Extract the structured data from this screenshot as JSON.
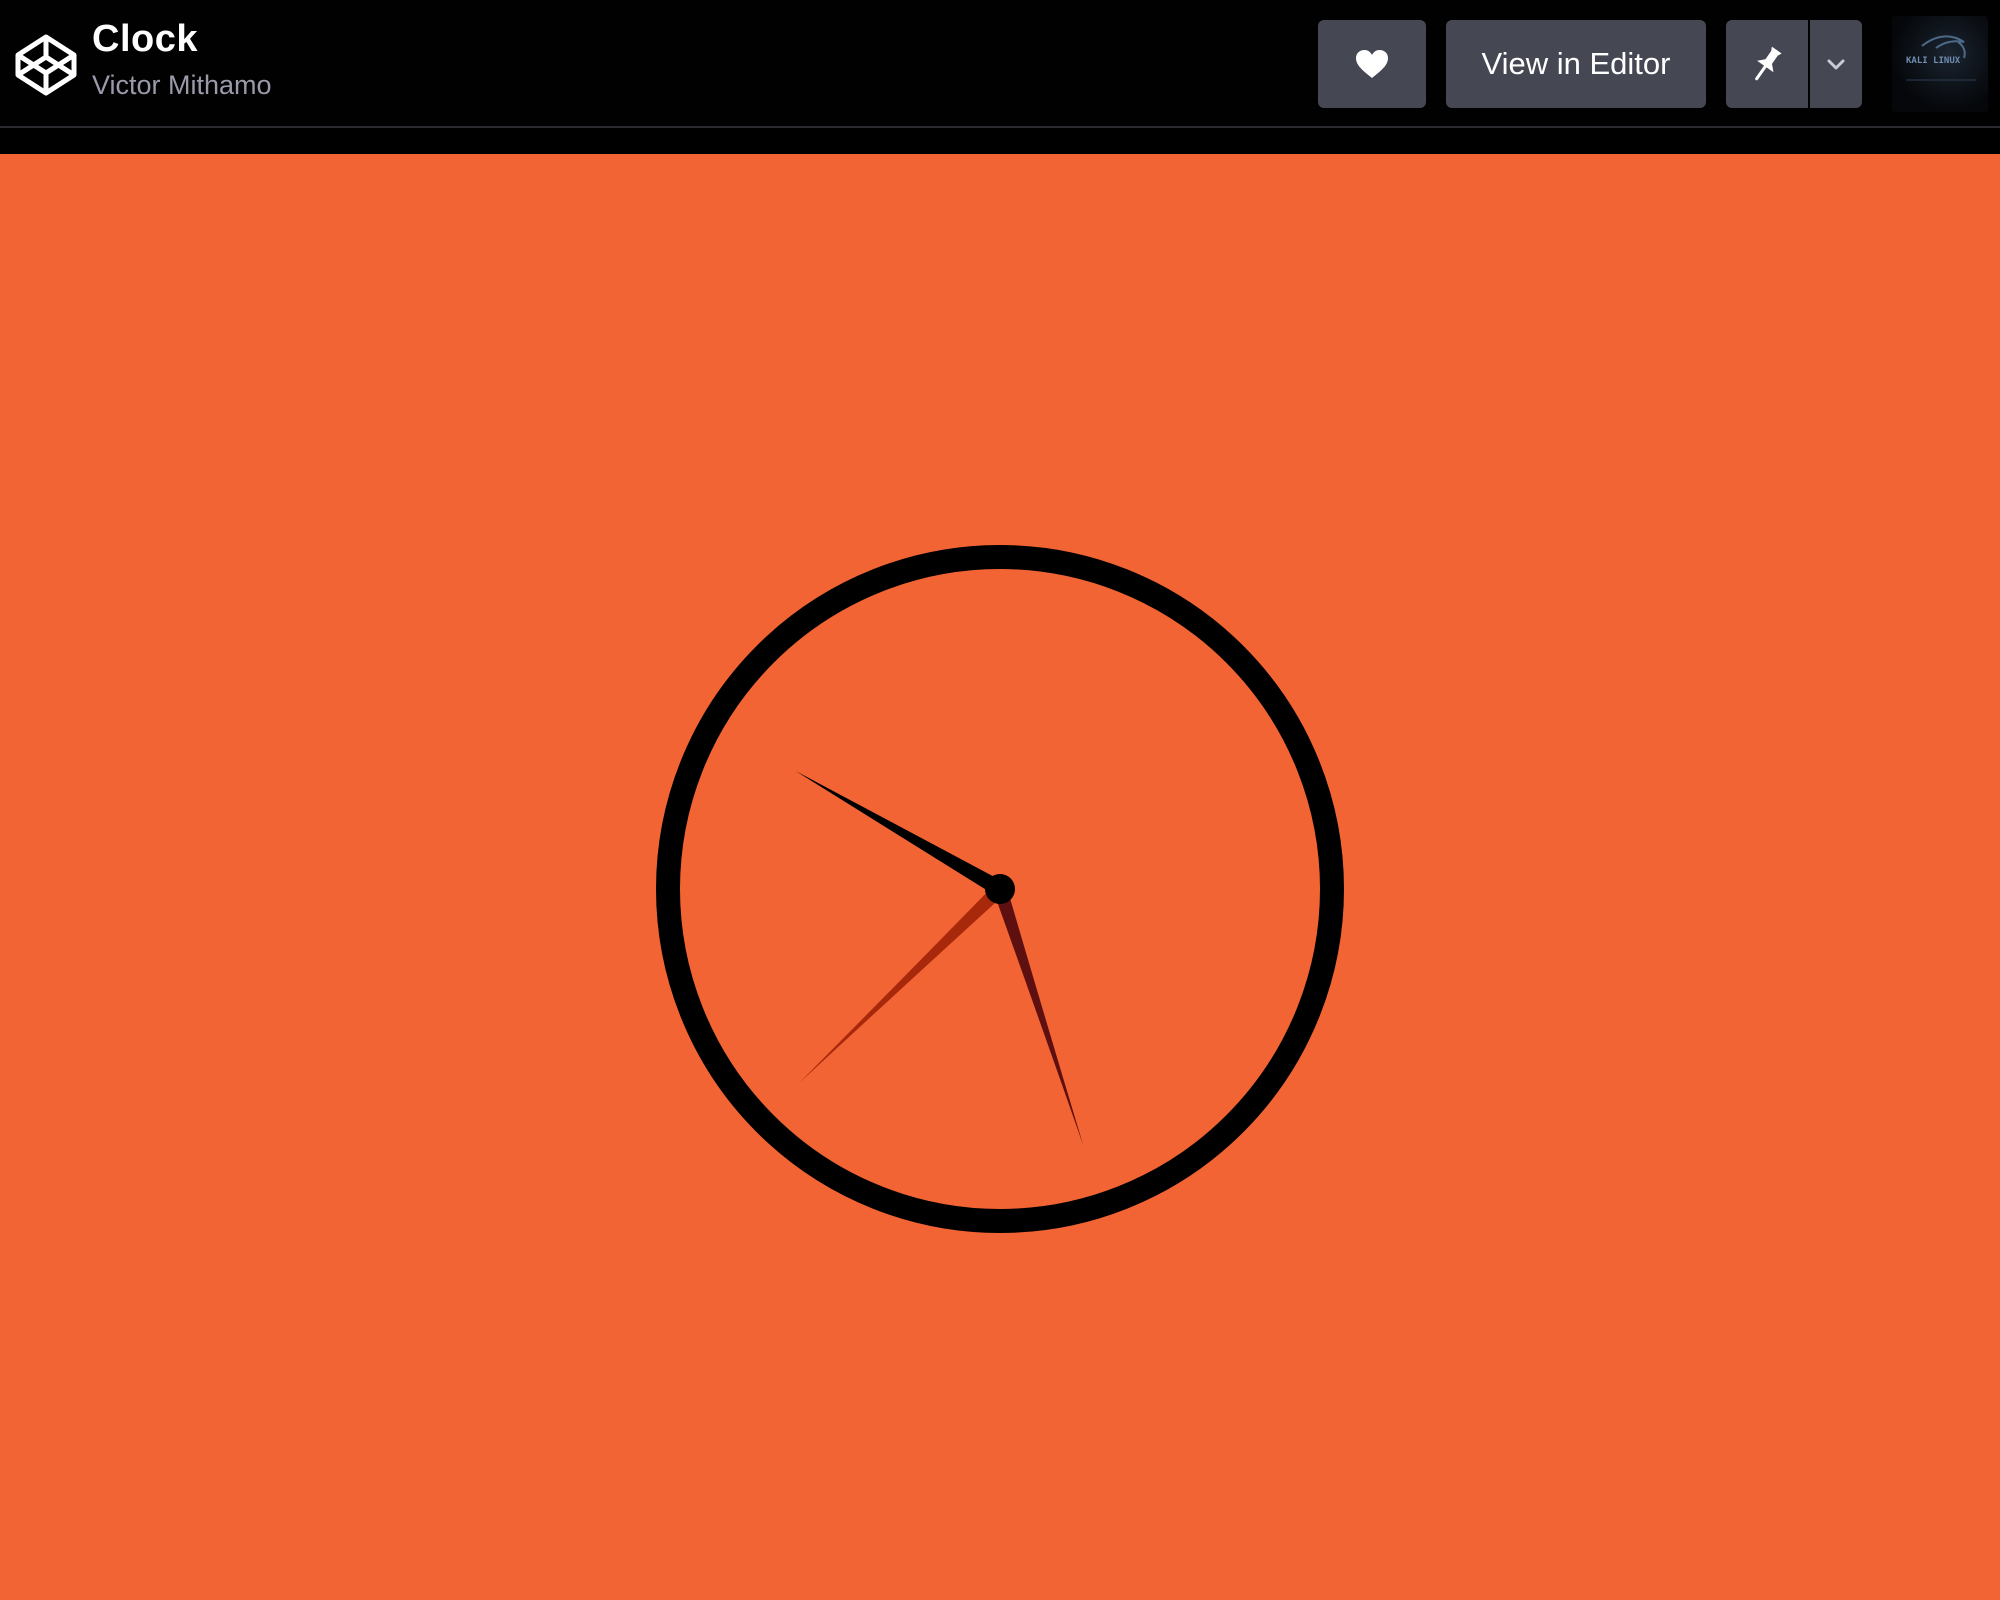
{
  "header": {
    "title": "Clock",
    "author": "Victor Mithamo",
    "view_in_editor_label": "View in Editor",
    "avatar_text": "KALI LINUX"
  },
  "icons": {
    "logo": "codepen-logo-icon",
    "love": "heart-icon",
    "pin": "pin-icon",
    "more": "chevron-down-icon"
  },
  "colors": {
    "stage_background": "#f26433",
    "clock_ring": "#000000",
    "hour_hand": "#000000",
    "minute_hand": "#5e0f10",
    "second_hand": "#a8280b"
  },
  "clock": {
    "hour_hand_angle_deg": 300,
    "minute_hand_angle_deg": 162,
    "second_hand_angle_deg": 226
  }
}
